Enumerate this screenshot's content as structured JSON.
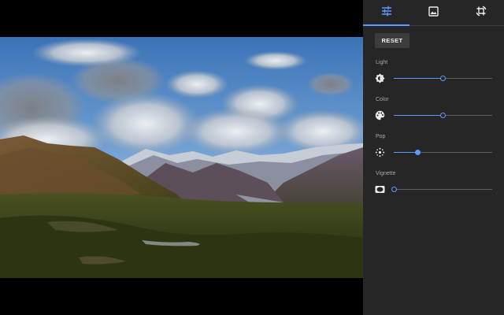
{
  "theme": {
    "accent": "#5b9bff",
    "panel_bg": "#262626",
    "icon_color": "#ececec"
  },
  "tabs": [
    {
      "name": "tab-adjust",
      "icon": "tune-sliders-icon",
      "selected": true
    },
    {
      "name": "tab-filters",
      "icon": "image-icon",
      "selected": false
    },
    {
      "name": "tab-crop",
      "icon": "crop-rotate-icon",
      "selected": false
    }
  ],
  "reset_button": {
    "label": "RESET"
  },
  "adjustments": [
    {
      "key": "light",
      "label": "Light",
      "icon": "brightness-icon",
      "value": 0.5
    },
    {
      "key": "color",
      "label": "Color",
      "icon": "palette-icon",
      "value": 0.5
    },
    {
      "key": "pop",
      "label": "Pop",
      "icon": "sparkle-icon",
      "value": 0.24
    },
    {
      "key": "vignette",
      "label": "Vignette",
      "icon": "vignette-icon",
      "value": 0.0
    }
  ]
}
